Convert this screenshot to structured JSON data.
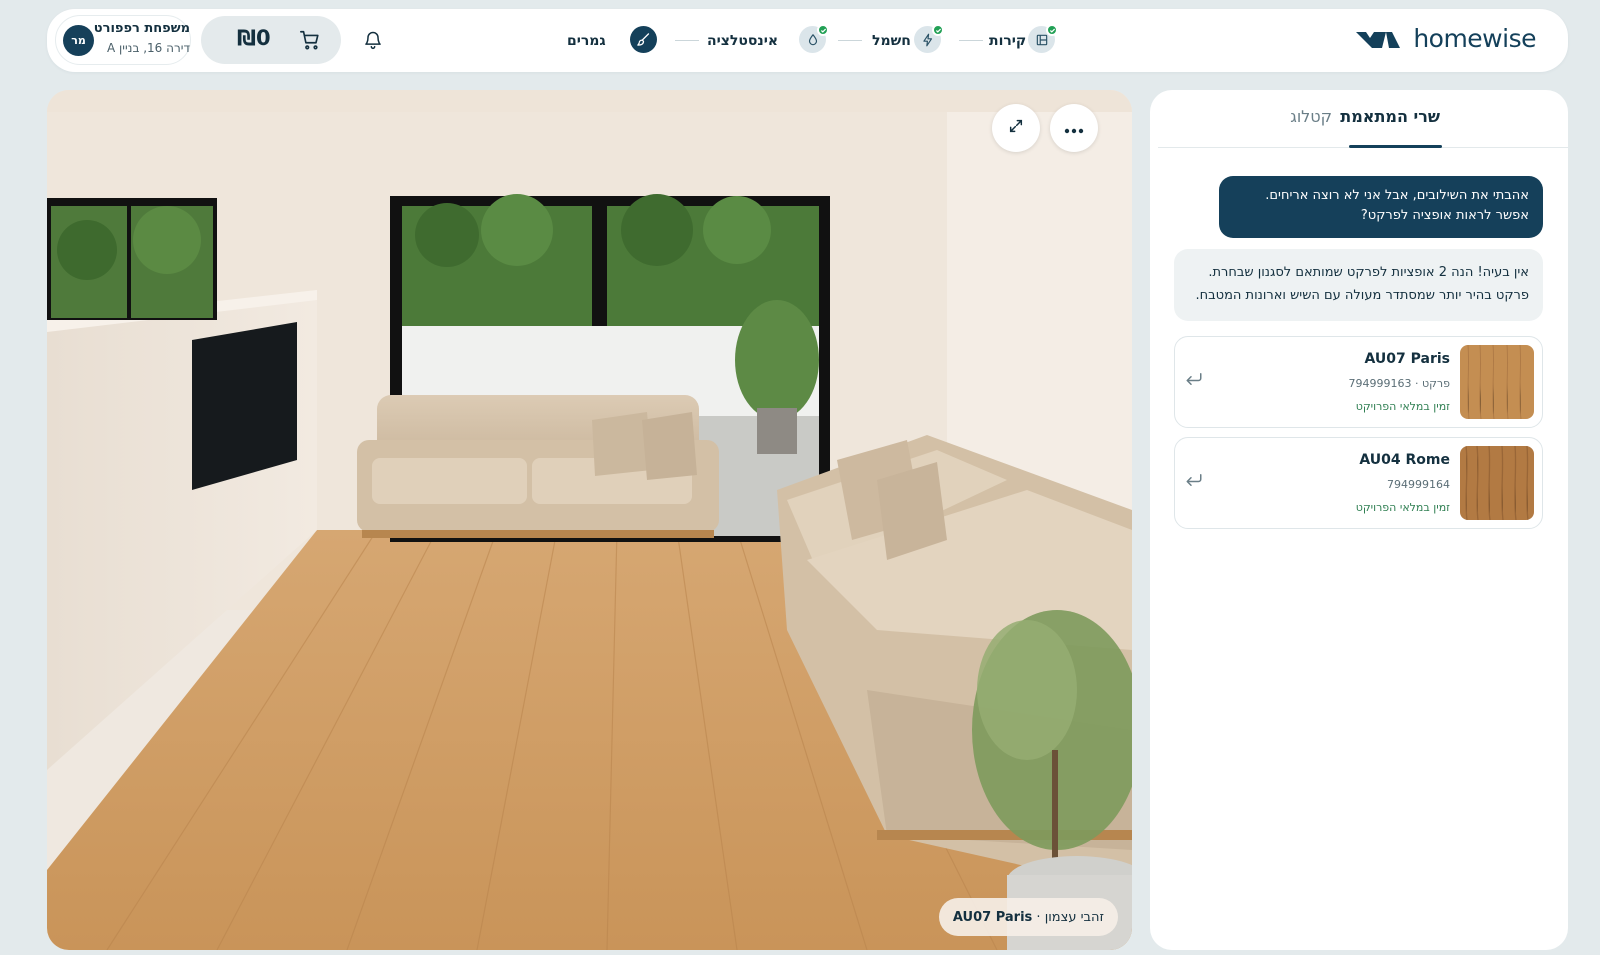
{
  "header": {
    "user": {
      "initials": "מר",
      "name": "משפחת רפפורט",
      "address": "דירה 16, בניין A"
    },
    "cart": {
      "amount": "₪0"
    },
    "steps": [
      {
        "label": "גמרים",
        "icon": "brush-icon",
        "state": "current"
      },
      {
        "label": "אינסטלציה",
        "icon": "water-drop-icon",
        "state": "done"
      },
      {
        "label": "חשמל",
        "icon": "lightning-icon",
        "state": "done"
      },
      {
        "label": "קירות",
        "icon": "wall-icon",
        "state": "done"
      }
    ],
    "logo": {
      "text": "homewise"
    }
  },
  "viewer": {
    "material_chip": {
      "color": "זהבי עצמון",
      "separator": " · ",
      "name": "AU07 Paris"
    }
  },
  "panel": {
    "tabs": [
      {
        "label": "שרי המתאמת",
        "active": true
      },
      {
        "label": "קטלוג",
        "active": false
      }
    ],
    "chat": {
      "user_message": "אהבתי את השילובים, אבל אני לא רוצה אריחים. אפשר לראות אופציה לפרקט?",
      "bot_message": "אין בעיה! הנה 2 אופציות לפרקט שמותאם לסגנון שבחרת. פרקט בהיר יותר שמסתדר מעולה עם השיש וארונות המטבח."
    },
    "products": [
      {
        "name": "AU07 Paris",
        "code": "פרקט · 794999163",
        "availability": "זמין במלאי הפרויקט"
      },
      {
        "name": "AU04 Rome",
        "code": "794999164",
        "availability": "זמין במלאי הפרויקט"
      }
    ]
  },
  "colors": {
    "brand": "#14405a",
    "success": "#22a055",
    "background": "#e3eaec"
  }
}
